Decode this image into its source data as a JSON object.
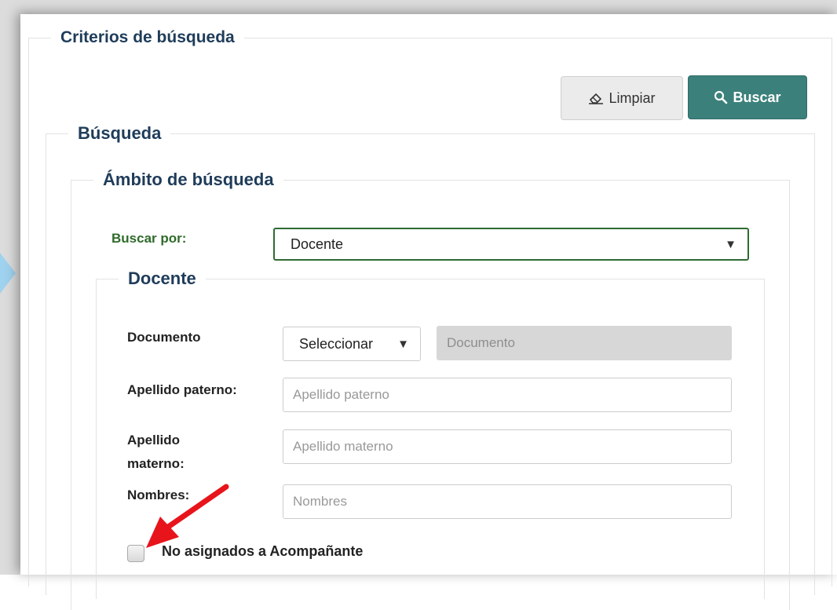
{
  "panel": {
    "legend": "Criterios de búsqueda"
  },
  "actions": {
    "clear_label": "Limpiar",
    "search_label": "Buscar"
  },
  "busqueda": {
    "legend": "Búsqueda"
  },
  "ambito": {
    "legend": "Ámbito de búsqueda",
    "search_by_label": "Buscar por:",
    "search_by_value": "Docente"
  },
  "docente": {
    "legend": "Docente",
    "document": {
      "label": "Documento",
      "type_value": "Seleccionar",
      "number_placeholder": "Documento"
    },
    "paternal": {
      "label": "Apellido paterno:",
      "placeholder": "Apellido paterno"
    },
    "maternal": {
      "label_line1": "Apellido",
      "label_line2": "materno:",
      "placeholder": "Apellido materno"
    },
    "names": {
      "label": "Nombres:",
      "placeholder": "Nombres"
    },
    "unassigned_checkbox": {
      "label": "No asignados a Acompañante",
      "checked": false
    }
  },
  "colors": {
    "primary_button": "#3b807b",
    "legend_text": "#1f3c5a",
    "focus_border": "#2e6b33",
    "annotation_arrow": "#e8141b"
  },
  "icons": {
    "clear": "eraser-icon",
    "search": "search-icon",
    "dropdown": "caret-down-icon",
    "annotation": "red-arrow-icon"
  }
}
